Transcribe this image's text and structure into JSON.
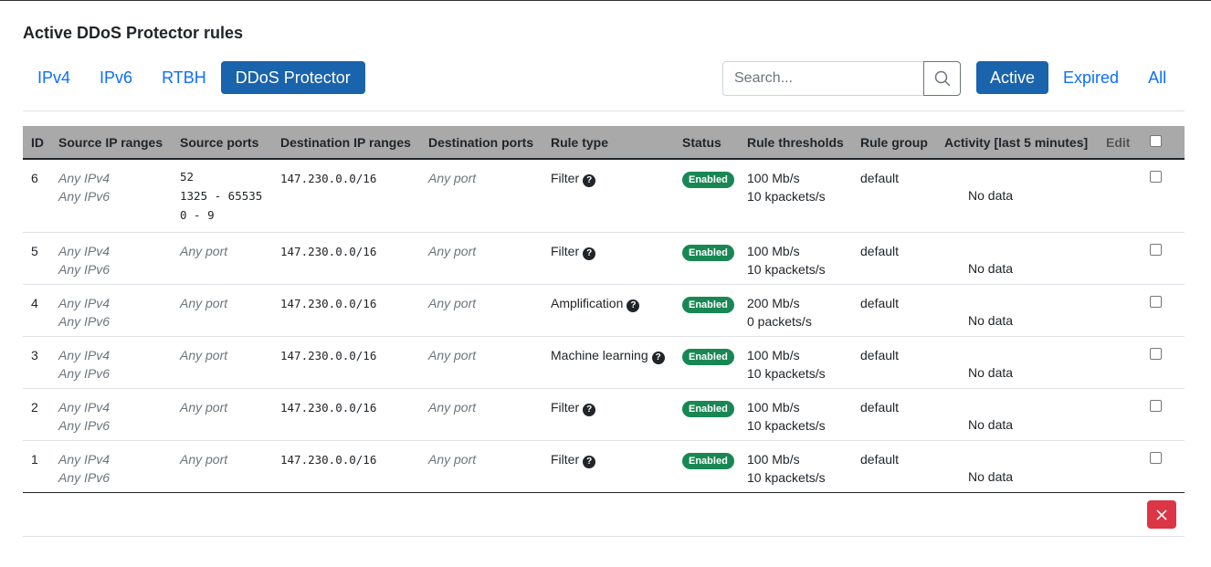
{
  "page": {
    "title": "Active DDoS Protector rules"
  },
  "tabs": [
    {
      "label": "IPv4"
    },
    {
      "label": "IPv6"
    },
    {
      "label": "RTBH"
    },
    {
      "label": "DDoS Protector"
    }
  ],
  "search": {
    "placeholder": "Search..."
  },
  "filters": [
    {
      "label": "Active"
    },
    {
      "label": "Expired"
    },
    {
      "label": "All"
    }
  ],
  "table": {
    "headers": {
      "id": "ID",
      "source_ip": "Source IP ranges",
      "source_ports": "Source ports",
      "dest_ip": "Destination IP ranges",
      "dest_ports": "Destination ports",
      "rule_type": "Rule type",
      "status": "Status",
      "thresholds": "Rule thresholds",
      "group": "Rule group",
      "activity": "Activity [last 5 minutes]",
      "edit": "Edit"
    },
    "rows": [
      {
        "id": "6",
        "src_ip": [
          "Any IPv4",
          "Any IPv6"
        ],
        "src_ports": [
          "52",
          "1325 - 65535",
          "0 - 9"
        ],
        "dst_ip": "147.230.0.0/16",
        "dst_ports": "Any port",
        "rule_type": "Filter",
        "status": "Enabled",
        "thr1": "100 Mb/s",
        "thr2": "10 kpackets/s",
        "group": "default",
        "activity": "No data"
      },
      {
        "id": "5",
        "src_ip": [
          "Any IPv4",
          "Any IPv6"
        ],
        "src_ports_text": "Any port",
        "dst_ip": "147.230.0.0/16",
        "dst_ports": "Any port",
        "rule_type": "Filter",
        "status": "Enabled",
        "thr1": "100 Mb/s",
        "thr2": "10 kpackets/s",
        "group": "default",
        "activity": "No data"
      },
      {
        "id": "4",
        "src_ip": [
          "Any IPv4",
          "Any IPv6"
        ],
        "src_ports_text": "Any port",
        "dst_ip": "147.230.0.0/16",
        "dst_ports": "Any port",
        "rule_type": "Amplification",
        "status": "Enabled",
        "thr1": "200 Mb/s",
        "thr2": "0 packets/s",
        "group": "default",
        "activity": "No data"
      },
      {
        "id": "3",
        "src_ip": [
          "Any IPv4",
          "Any IPv6"
        ],
        "src_ports_text": "Any port",
        "dst_ip": "147.230.0.0/16",
        "dst_ports": "Any port",
        "rule_type": "Machine learning",
        "status": "Enabled",
        "thr1": "100 Mb/s",
        "thr2": "10 kpackets/s",
        "group": "default",
        "activity": "No data"
      },
      {
        "id": "2",
        "src_ip": [
          "Any IPv4",
          "Any IPv6"
        ],
        "src_ports_text": "Any port",
        "dst_ip": "147.230.0.0/16",
        "dst_ports": "Any port",
        "rule_type": "Filter",
        "status": "Enabled",
        "thr1": "100 Mb/s",
        "thr2": "10 kpackets/s",
        "group": "default",
        "activity": "No data"
      },
      {
        "id": "1",
        "src_ip": [
          "Any IPv4",
          "Any IPv6"
        ],
        "src_ports_text": "Any port",
        "dst_ip": "147.230.0.0/16",
        "dst_ports": "Any port",
        "rule_type": "Filter",
        "status": "Enabled",
        "thr1": "100 Mb/s",
        "thr2": "10 kpackets/s",
        "group": "default",
        "activity": "No data"
      }
    ]
  },
  "icons": {
    "search": "search-icon",
    "help": "question-circle-icon",
    "delete": "close-icon"
  },
  "colors": {
    "primary": "#1a63ad",
    "link": "#0d6efd",
    "success": "#198754",
    "danger": "#dc3545",
    "header_bg": "#a9a9a9"
  }
}
